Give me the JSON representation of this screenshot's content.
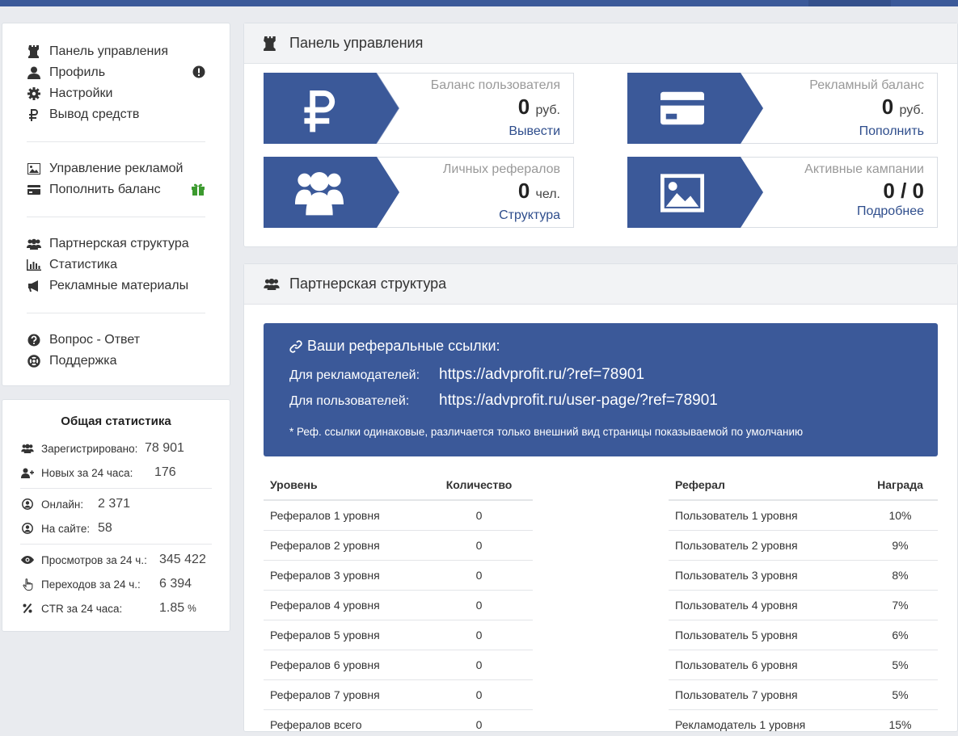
{
  "sidebar": {
    "groups": [
      [
        {
          "label": "Панель управления",
          "icon": "rook-icon"
        },
        {
          "label": "Профиль",
          "icon": "user-icon",
          "badge": "exclamation-circle-icon"
        },
        {
          "label": "Настройки",
          "icon": "gear-icon"
        },
        {
          "label": "Вывод средств",
          "icon": "ruble-icon"
        }
      ],
      [
        {
          "label": "Управление рекламой",
          "icon": "image-icon"
        },
        {
          "label": "Пополнить баланс",
          "icon": "credit-card-icon",
          "badge": "gift-icon"
        }
      ],
      [
        {
          "label": "Партнерская структура",
          "icon": "users-icon"
        },
        {
          "label": "Статистика",
          "icon": "bar-chart-icon"
        },
        {
          "label": "Рекламные материалы",
          "icon": "bullhorn-icon"
        }
      ],
      [
        {
          "label": "Вопрос - Ответ",
          "icon": "question-circle-icon"
        },
        {
          "label": "Поддержка",
          "icon": "life-ring-icon"
        }
      ]
    ]
  },
  "stats": {
    "title": "Общая статистика",
    "rows": [
      {
        "label": "Зарегистрировано:",
        "value": "78 901",
        "icon": "users-icon"
      },
      {
        "label": "Новых за 24 часа:",
        "value": "176",
        "icon": "user-plus-icon"
      },
      {
        "label": "Онлайн:",
        "value": "2 371",
        "icon": "user-circle-icon"
      },
      {
        "label": "На сайте:",
        "value": "58",
        "icon": "user-circle-icon"
      },
      {
        "label": "Просмотров за 24 ч.:",
        "value": "345 422",
        "icon": "eye-icon"
      },
      {
        "label": "Переходов за 24 ч.:",
        "value": "6 394",
        "icon": "pointer-icon"
      },
      {
        "label": "CTR за 24 часа:",
        "value": "1.85",
        "unit": "%",
        "icon": "percent-icon"
      }
    ]
  },
  "dashboard": {
    "title": "Панель управления",
    "tiles": [
      {
        "label": "Баланс пользователя",
        "value": "0",
        "unit": "руб.",
        "link": "Вывести",
        "icon": "ruble-icon"
      },
      {
        "label": "Рекламный баланс",
        "value": "0",
        "unit": "руб.",
        "link": "Пополнить",
        "icon": "credit-card-icon"
      },
      {
        "label": "Личных рефералов",
        "value": "0",
        "unit": "чел.",
        "link": "Структура",
        "icon": "users-icon"
      },
      {
        "label": "Активные кампании",
        "value": "0 / 0",
        "unit": "",
        "link": "Подробнее",
        "icon": "image-icon"
      }
    ]
  },
  "partners": {
    "title": "Партнерская структура",
    "ref_title": "Ваши реферальные ссылки:",
    "advertisers_label": "Для рекламодателей:",
    "advertisers_link": "https://advprofit.ru/?ref=78901",
    "users_label": "Для пользователей:",
    "users_link": "https://advprofit.ru/user-page/?ref=78901",
    "note": "* Реф. ссылки одинаковые, различается только внешний вид страницы показываемой по умолчанию",
    "levels": {
      "headers": [
        "Уровень",
        "Количество"
      ],
      "rows": [
        [
          "Рефералов 1 уровня",
          "0"
        ],
        [
          "Рефералов 2 уровня",
          "0"
        ],
        [
          "Рефералов 3 уровня",
          "0"
        ],
        [
          "Рефералов 4 уровня",
          "0"
        ],
        [
          "Рефералов 5 уровня",
          "0"
        ],
        [
          "Рефералов 6 уровня",
          "0"
        ],
        [
          "Рефералов 7 уровня",
          "0"
        ],
        [
          "Рефералов всего",
          "0"
        ]
      ]
    },
    "rewards": {
      "headers": [
        "Реферал",
        "Награда"
      ],
      "rows": [
        [
          "Пользователь 1 уровня",
          "10%"
        ],
        [
          "Пользователь 2 уровня",
          "9%"
        ],
        [
          "Пользователь 3 уровня",
          "8%"
        ],
        [
          "Пользователь 4 уровня",
          "7%"
        ],
        [
          "Пользователь 5 уровня",
          "6%"
        ],
        [
          "Пользователь 6 уровня",
          "5%"
        ],
        [
          "Пользователь 7 уровня",
          "5%"
        ],
        [
          "Рекламодатель 1 уровня",
          "15%"
        ]
      ]
    }
  },
  "colors": {
    "brand": "#3b5999",
    "link": "#2e4d8c",
    "gift": "#3c9a2f"
  }
}
